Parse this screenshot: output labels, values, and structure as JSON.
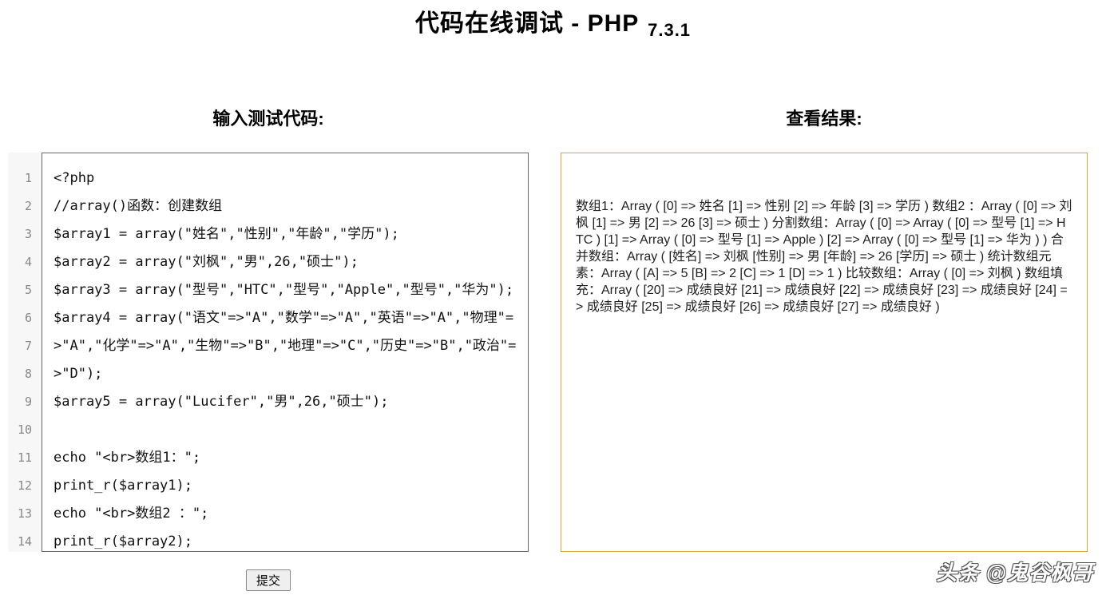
{
  "header": {
    "title_main": "代码在线调试 - PHP",
    "version": "7.3.1"
  },
  "left": {
    "heading": "输入测试代码:",
    "line_numbers": [
      "1",
      "2",
      "3",
      "4",
      "5",
      "6",
      "7",
      "8",
      "9",
      "10",
      "11",
      "12",
      "13",
      "14"
    ],
    "code": "<?php\n//array()函数：创建数组\n$array1 = array(\"姓名\",\"性别\",\"年龄\",\"学历\");\n$array2 = array(\"刘枫\",\"男\",26,\"硕士\");\n$array3 = array(\"型号\",\"HTC\",\"型号\",\"Apple\",\"型号\",\"华为\");\n$array4 = array(\"语文\"=>\"A\",\"数学\"=>\"A\",\"英语\"=>\"A\",\"物理\"=>\"A\",\"化学\"=>\"A\",\"生物\"=>\"B\",\"地理\"=>\"C\",\"历史\"=>\"B\",\"政治\"=>\"D\");\n$array5 = array(\"Lucifer\",\"男\",26,\"硕士\");\n\necho \"<br>数组1：\";\nprint_r($array1);\necho \"<br>数组2 ：\";\nprint_r($array2);\n"
  },
  "right": {
    "heading": "查看结果:",
    "output_lines": [
      "数组1：Array ( [0] => 姓名 [1] => 性别 [2] => 年龄 [3] => 学历 )",
      "数组2 ：Array ( [0] => 刘枫 [1] => 男 [2] => 26 [3] => 硕士 )",
      "分割数组：Array ( [0] => Array ( [0] => 型号 [1] => HTC ) [1] => Array ( [0] => 型号 [1] => Apple ) [2] => Array ( [0] => 型号 [1] => 华为 ) )",
      "合并数组：Array ( [姓名] => 刘枫 [性别] => 男 [年龄] => 26 [学历] => 硕士 )",
      "统计数组元素：Array ( [A] => 5 [B] => 2 [C] => 1 [D] => 1 )",
      "比较数组：Array ( [0] => 刘枫 )",
      "数组填充：Array ( [20] => 成绩良好 [21] => 成绩良好 [22] => 成绩良好 [23] => 成绩良好 [24] => 成绩良好 [25] => 成绩良好 [26] => 成绩良好 [27] => 成绩良好 )"
    ]
  },
  "actions": {
    "submit_label": "提交"
  },
  "watermark": "头条 @鬼谷枫哥"
}
